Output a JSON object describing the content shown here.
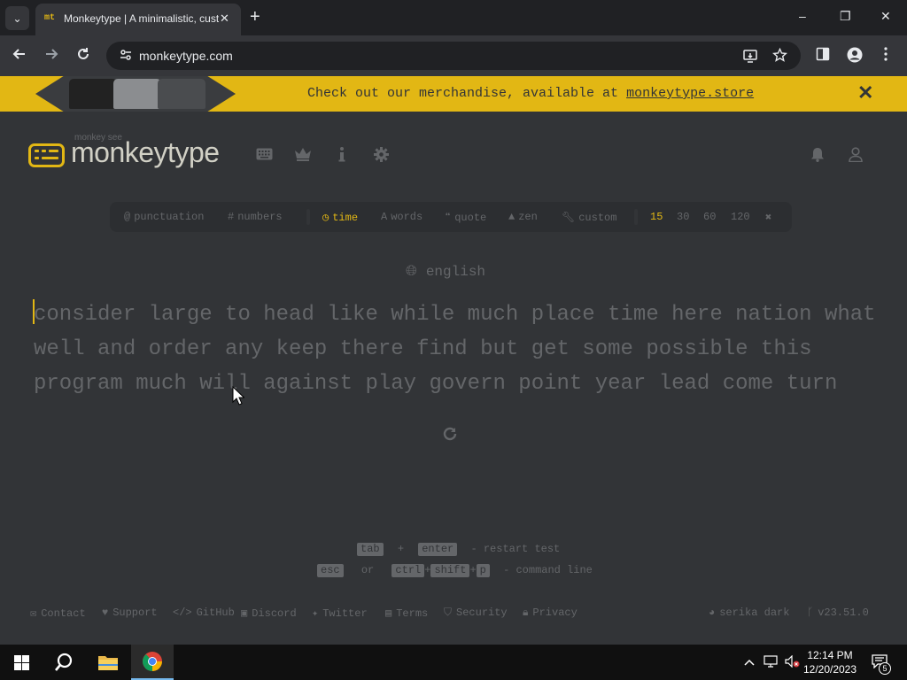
{
  "browser": {
    "tab_title": "Monkeytype | A minimalistic, customizable typing test",
    "tab_favicon_text": "mt",
    "tab_close": "✕",
    "new_tab": "+",
    "url": "monkeytype.com",
    "window_controls": {
      "minimize": "–",
      "restore": "❐",
      "close": "✕"
    }
  },
  "banner": {
    "text": "Check out our merchandise, available at ",
    "link": "monkeytype.store",
    "close": "✕"
  },
  "header": {
    "logo_sub": "monkey see",
    "logo_text": "monkeytype",
    "icons": [
      "keyboard-icon",
      "crown-icon",
      "info-icon",
      "gear-icon",
      "bell-icon",
      "user-icon"
    ]
  },
  "config": {
    "punctuation": "punctuation",
    "numbers": "numbers",
    "modes": {
      "time": "time",
      "words": "words",
      "quote": "quote",
      "zen": "zen",
      "custom": "custom"
    },
    "active_mode": "time",
    "durations": [
      "15",
      "30",
      "60",
      "120"
    ],
    "active_duration": "15"
  },
  "test": {
    "language": "english",
    "words": "consider large to head like while much place time here nation what well and order any keep there find but get some possible this program much will against play govern point year lead come turn"
  },
  "hints": {
    "tab": "tab",
    "plus": "+",
    "enter": "enter",
    "restart": "- restart test",
    "esc": "esc",
    "or": "or",
    "ctrl": "ctrl",
    "shift": "shift",
    "p": "p",
    "command": "- command line"
  },
  "footer": {
    "contact": "Contact",
    "support": "Support",
    "github": "GitHub",
    "discord": "Discord",
    "twitter": "Twitter",
    "terms": "Terms",
    "security": "Security",
    "privacy": "Privacy",
    "theme": "serika dark",
    "version": "v23.51.0"
  },
  "taskbar": {
    "time": "12:14 PM",
    "date": "12/20/2023",
    "notifications": "5"
  },
  "colors": {
    "background": "#323437",
    "main": "#e2b714",
    "sub": "#646669",
    "text": "#d1d0c5"
  }
}
